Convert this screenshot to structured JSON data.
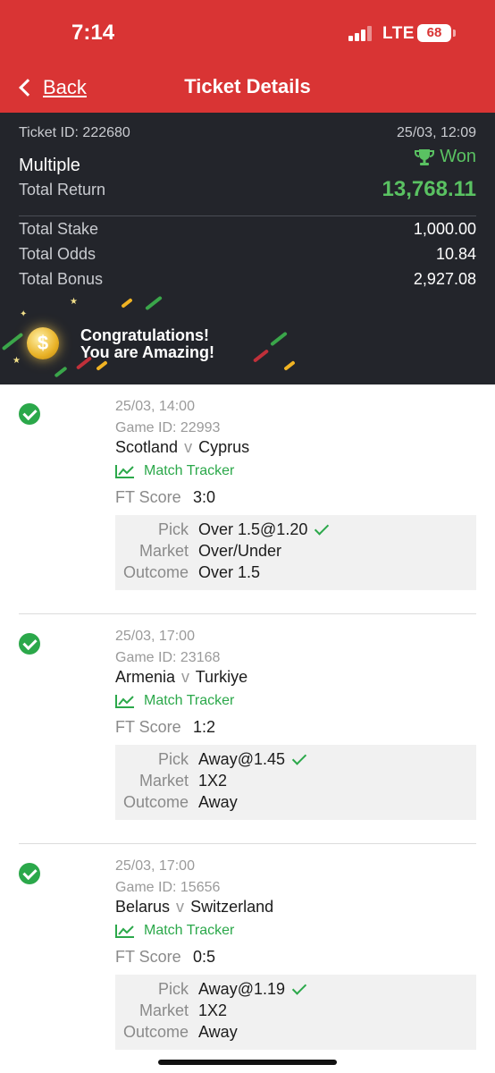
{
  "status_bar": {
    "time": "7:14",
    "network": "LTE",
    "battery": "68"
  },
  "nav": {
    "back_label": "Back",
    "title": "Ticket Details"
  },
  "summary": {
    "ticket_id": "Ticket ID: 222680",
    "date": "25/03, 12:09",
    "bet_type": "Multiple",
    "status": "Won",
    "total_return_label": "Total Return",
    "total_return": "13,768.11",
    "rows": [
      {
        "label": "Total Stake",
        "value": "1,000.00"
      },
      {
        "label": "Total Odds",
        "value": "10.84"
      },
      {
        "label": "Total Bonus",
        "value": "2,927.08"
      }
    ]
  },
  "banner": {
    "line1": "Congratulations!",
    "line2": "You are Amazing!"
  },
  "selection_labels": {
    "tracker": "Match Tracker",
    "score": "FT Score",
    "pick": "Pick",
    "market": "Market",
    "outcome": "Outcome",
    "versus": "v"
  },
  "selections": [
    {
      "date": "25/03, 14:00",
      "game_id": "Game ID: 22993",
      "home": "Scotland",
      "away": "Cyprus",
      "score": "3:0",
      "pick": "Over 1.5@1.20",
      "market": "Over/Under",
      "outcome": "Over 1.5"
    },
    {
      "date": "25/03, 17:00",
      "game_id": "Game ID: 23168",
      "home": "Armenia",
      "away": "Turkiye",
      "score": "1:2",
      "pick": "Away@1.45",
      "market": "1X2",
      "outcome": "Away"
    },
    {
      "date": "25/03, 17:00",
      "game_id": "Game ID: 15656",
      "home": "Belarus",
      "away": "Switzerland",
      "score": "0:5",
      "pick": "Away@1.19",
      "market": "1X2",
      "outcome": "Away"
    }
  ],
  "colors": {
    "header_red": "#d93434",
    "summary_dark": "#23252b",
    "won_green": "#5ac262",
    "check_green": "#2ba84a"
  }
}
